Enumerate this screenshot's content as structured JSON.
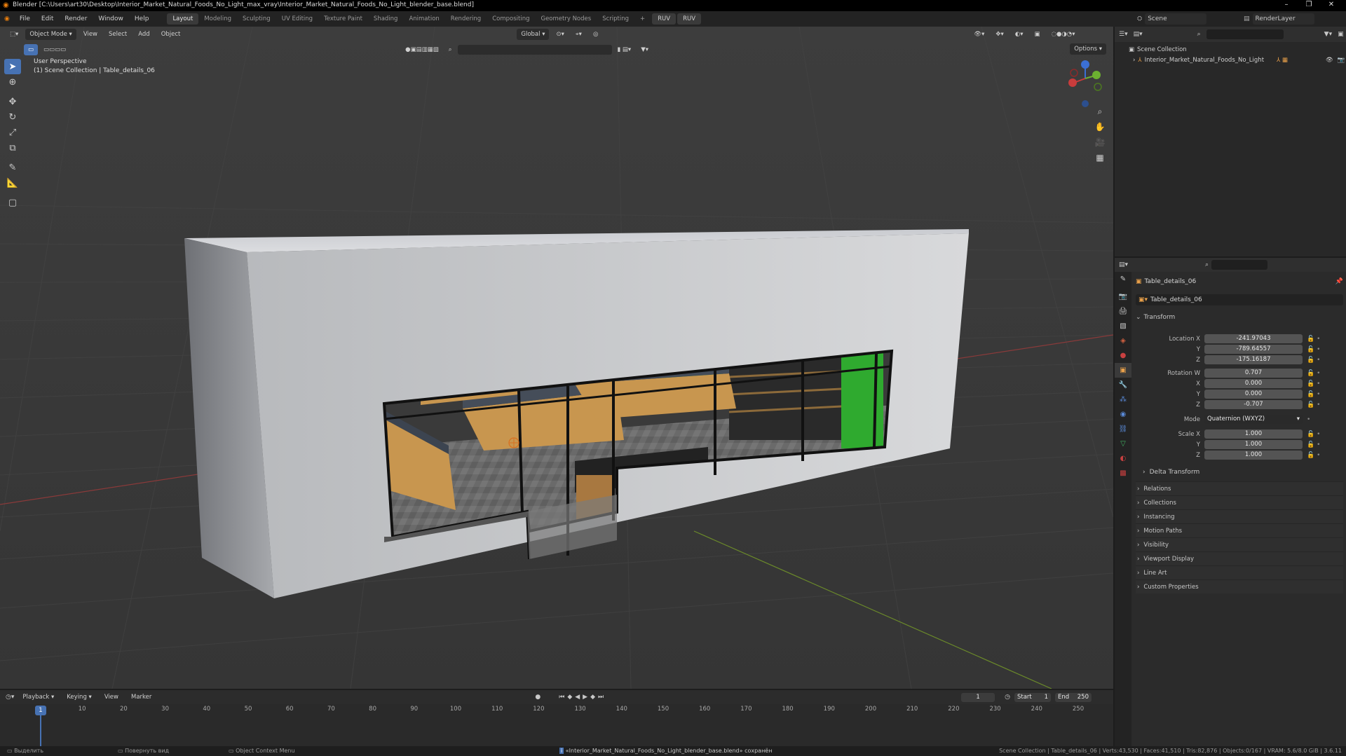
{
  "window": {
    "title": "Blender [C:\\Users\\art30\\Desktop\\Interior_Market_Natural_Foods_No_Light_max_vray\\Interior_Market_Natural_Foods_No_Light_blender_base.blend]",
    "controls": [
      "–",
      "❐",
      "✕"
    ]
  },
  "menu": [
    "File",
    "Edit",
    "Render",
    "Window",
    "Help"
  ],
  "workspaces": [
    {
      "label": "Layout",
      "active": true
    },
    {
      "label": "Modeling"
    },
    {
      "label": "Sculpting"
    },
    {
      "label": "UV Editing"
    },
    {
      "label": "Texture Paint"
    },
    {
      "label": "Shading"
    },
    {
      "label": "Animation"
    },
    {
      "label": "Rendering"
    },
    {
      "label": "Compositing"
    },
    {
      "label": "Geometry Nodes"
    },
    {
      "label": "Scripting"
    }
  ],
  "workspace_add": "+",
  "ruv": [
    "RUV",
    "RUV"
  ],
  "scene": {
    "label": "Scene",
    "render_layer": "RenderLayer"
  },
  "viewport": {
    "mode": "Object Mode",
    "menus": [
      "View",
      "Select",
      "Add",
      "Object"
    ],
    "orientation": "Global",
    "options": "Options",
    "overlay_line1": "User Perspective",
    "overlay_line2": "(1) Scene Collection | Table_details_06"
  },
  "outliner": {
    "root": "Scene Collection",
    "items": [
      "Interior_Market_Natural_Foods_No_Light"
    ]
  },
  "properties": {
    "object_name": "Table_details_06",
    "data_name": "Table_details_06",
    "transform_label": "Transform",
    "location": {
      "label": "Location X",
      "x": "-241.97043",
      "y": "-789.64557",
      "z": "-175.16187"
    },
    "rotation": {
      "label": "Rotation W",
      "w": "0.707",
      "x": "0.000",
      "y": "0.000",
      "z": "-0.707"
    },
    "mode": {
      "label": "Mode",
      "value": "Quaternion (WXYZ)"
    },
    "scale": {
      "label": "Scale X",
      "x": "1.000",
      "y": "1.000",
      "z": "1.000"
    },
    "axis_labels": {
      "x": "X",
      "y": "Y",
      "z": "Z"
    },
    "delta": "Delta Transform",
    "panels": [
      "Relations",
      "Collections",
      "Instancing",
      "Motion Paths",
      "Visibility",
      "Viewport Display",
      "Line Art",
      "Custom Properties"
    ]
  },
  "timeline": {
    "menus": [
      "Playback",
      "Keying",
      "View",
      "Marker"
    ],
    "current_frame": "1",
    "start_label": "Start",
    "start": "1",
    "end_label": "End",
    "end": "250",
    "ticks": [
      "10",
      "20",
      "30",
      "40",
      "50",
      "60",
      "70",
      "80",
      "90",
      "100",
      "110",
      "120",
      "130",
      "140",
      "150",
      "160",
      "170",
      "180",
      "190",
      "200",
      "210",
      "220",
      "230",
      "240",
      "250"
    ]
  },
  "status": {
    "select": "Выделить",
    "rotate": "Повернуть вид",
    "context": "Object Context Menu",
    "message": "«Interior_Market_Natural_Foods_No_Light_blender_base.blend» сохранён",
    "stats": "Scene Collection | Table_details_06 | Verts:43,530 | Faces:41,510 | Tris:82,876 | Objects:0/167 | VRAM: 5.6/8.0 GiB | 3.6.11"
  },
  "colors": {
    "accent": "#4772b3",
    "grid_x": "#8a3a3a",
    "grid_y": "#6b8a2a",
    "green_panel": "#2faa2f"
  }
}
